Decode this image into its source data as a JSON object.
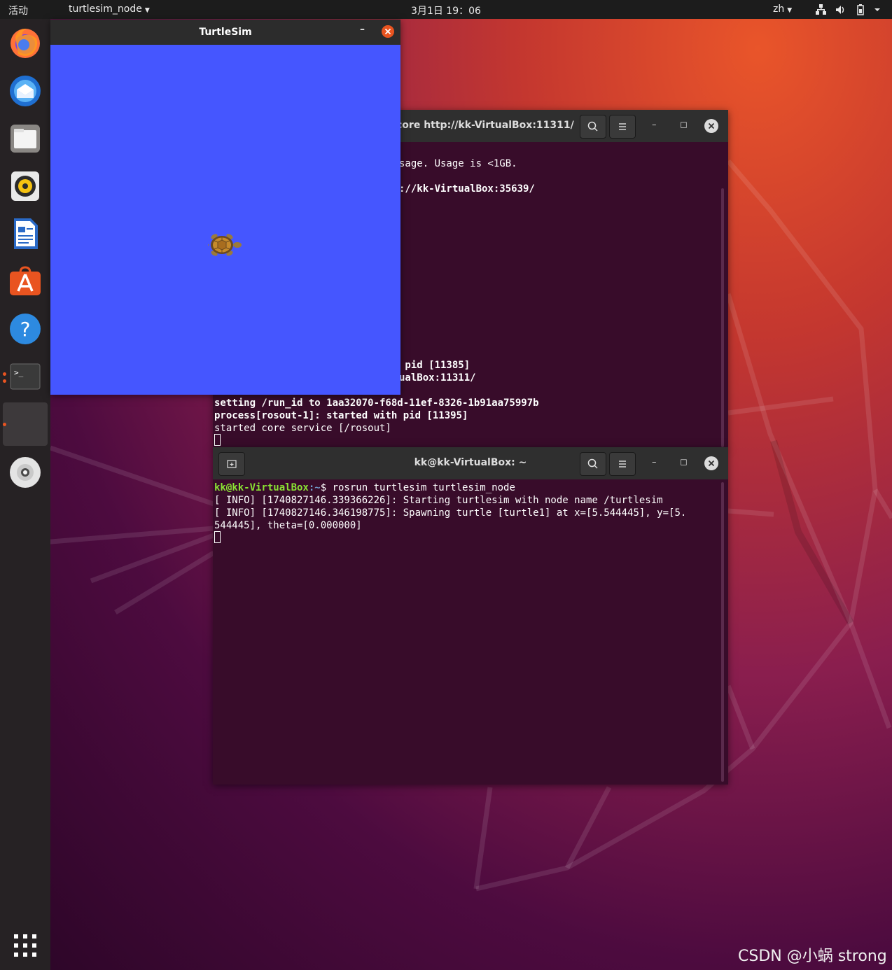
{
  "topbar": {
    "activities": "活动",
    "app_menu": "turtlesim_node",
    "clock": "3月1日 19：06",
    "language": "zh"
  },
  "dock": {
    "items": [
      "firefox",
      "thunderbird",
      "files",
      "rhythmbox",
      "libreoffice-writer",
      "ubuntu-software",
      "help",
      "terminal",
      "turtlesim",
      "dvd"
    ]
  },
  "turtlesim": {
    "title": "TurtleSim",
    "background_color": "#4556ff"
  },
  "terminal_back": {
    "title": "core http://kk-VirtualBox:11311/",
    "lines": [
      {
        "text": "sage. Usage is <1GB.",
        "bold": false
      },
      {
        "text": "://kk-VirtualBox:35639/",
        "bold": true
      },
      {
        "text": " pid [11385]",
        "bold": true
      },
      {
        "text": "ualBox:11311/",
        "bold": true
      },
      {
        "text": "setting /run_id to 1aa32070-f68d-11ef-8326-1b91aa75997b",
        "bold": true
      },
      {
        "text": "process[rosout-1]: started with pid [11395]",
        "bold": true
      },
      {
        "text": "started core service [/rosout]",
        "bold": false
      }
    ]
  },
  "terminal_front": {
    "title": "kk@kk-VirtualBox: ~",
    "prompt_user": "kk@kk-VirtualBox",
    "prompt_path": ":~",
    "prompt_symbol": "$ ",
    "command": "rosrun turtlesim turtlesim_node",
    "output": [
      "[ INFO] [1740827146.339366226]: Starting turtlesim with node name /turtlesim",
      "[ INFO] [1740827146.346198775]: Spawning turtle [turtle1] at x=[5.544445], y=[5.",
      "544445], theta=[0.000000]"
    ]
  },
  "watermark": "CSDN @小蜗 strong"
}
